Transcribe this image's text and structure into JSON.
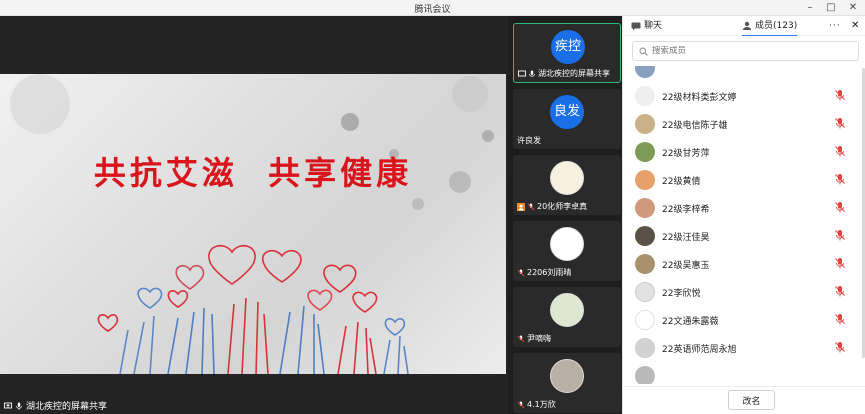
{
  "window": {
    "title": "腾讯会议",
    "min_icon": "minimize-icon",
    "max_icon": "maximize-icon",
    "close_icon": "close-icon"
  },
  "main": {
    "slide_title": "共抗艾滋  共享健康",
    "share_label": "湖北疾控的屏幕共享"
  },
  "video_tiles": [
    {
      "label": "湖北疾控的屏幕共享",
      "avatar_text": "疾控",
      "active": true
    },
    {
      "label": "许良发",
      "avatar_text": "良发"
    },
    {
      "label": "20化师李卓真"
    },
    {
      "label": "2206刘雨晴"
    },
    {
      "label": "尹嘀嗨"
    },
    {
      "label": "4.1万欣"
    }
  ],
  "panel": {
    "tab_chat": "聊天",
    "tab_members": "成员(123)",
    "more_icon": "more-icon",
    "search_placeholder": "搜索成员",
    "members": [
      {
        "name": "22级材料类彭文婷",
        "color": "#eeeeee"
      },
      {
        "name": "22级电信陈子雄",
        "color": "#c9b28a"
      },
      {
        "name": "22级甘芳萍",
        "color": "#7e9a58"
      },
      {
        "name": "22级黄倩",
        "color": "#e7a06a"
      },
      {
        "name": "22级李梓希",
        "color": "#d0987c"
      },
      {
        "name": "22级汪佳昊",
        "color": "#5a5246"
      },
      {
        "name": "22级吴惠玉",
        "color": "#a9906f"
      },
      {
        "name": "22李欣悦",
        "color": "#e2e2e2"
      },
      {
        "name": "22文通朱露薇",
        "color": "#ffffff"
      },
      {
        "name": "22英语师范周永旭",
        "color": "#d2d2d2"
      }
    ],
    "rename_button": "改名",
    "mic_muted_color": "#e8413c"
  }
}
